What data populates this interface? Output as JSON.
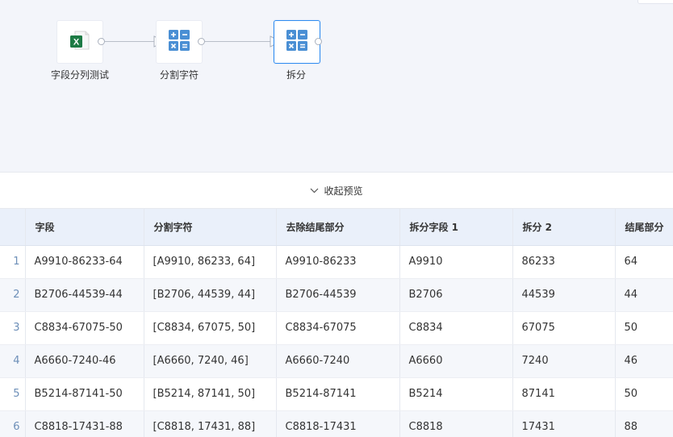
{
  "flow": {
    "nodes": [
      {
        "label": "字段分列测试",
        "icon": "excel-icon"
      },
      {
        "label": "分割字符",
        "icon": "calculator-icon"
      },
      {
        "label": "拆分",
        "icon": "calculator-icon",
        "selected": true
      }
    ]
  },
  "collapse": {
    "label": "收起预览",
    "icon": "chevron-down-icon"
  },
  "table": {
    "headers": [
      "字段",
      "分割字符",
      "去除结尾部分",
      "拆分字段 1",
      "拆分 2",
      "结尾部分"
    ],
    "rows": [
      {
        "index": "1",
        "cells": [
          "A9910-86233-64",
          "[A9910, 86233, 64]",
          "A9910-86233",
          "A9910",
          "86233",
          "64"
        ]
      },
      {
        "index": "2",
        "cells": [
          "B2706-44539-44",
          "[B2706, 44539, 44]",
          "B2706-44539",
          "B2706",
          "44539",
          "44"
        ]
      },
      {
        "index": "3",
        "cells": [
          "C8834-67075-50",
          "[C8834, 67075, 50]",
          "C8834-67075",
          "C8834",
          "67075",
          "50"
        ]
      },
      {
        "index": "4",
        "cells": [
          "A6660-7240-46",
          "[A6660, 7240, 46]",
          "A6660-7240",
          "A6660",
          "7240",
          "46"
        ]
      },
      {
        "index": "5",
        "cells": [
          "B5214-87141-50",
          "[B5214, 87141, 50]",
          "B5214-87141",
          "B5214",
          "87141",
          "50"
        ]
      },
      {
        "index": "6",
        "cells": [
          "C8818-17431-88",
          "[C8818, 17431, 88]",
          "C8818-17431",
          "C8818",
          "17431",
          "88"
        ]
      }
    ]
  },
  "colors": {
    "accent": "#2f8cf0",
    "header_bg": "#eaf0fa",
    "excel_green": "#1d7a44",
    "calc_blue": "#4a8fd4"
  }
}
